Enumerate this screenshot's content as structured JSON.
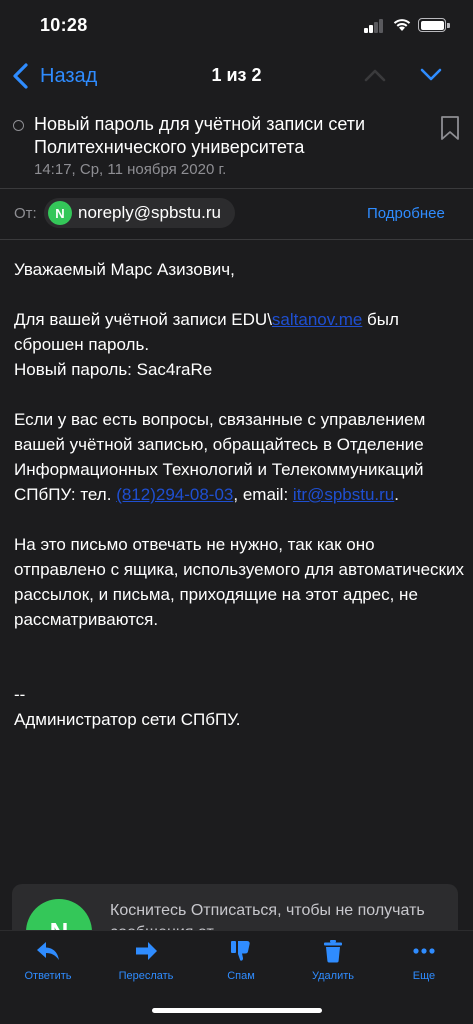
{
  "status_bar": {
    "time": "10:28"
  },
  "nav": {
    "back_label": "Назад",
    "counter": "1 из 2"
  },
  "message": {
    "subject": "Новый пароль для учётной записи сети Политехнического университета",
    "date": "14:17, Ср, 11 ноября 2020 г.",
    "from_label": "От:",
    "sender_initial": "N",
    "sender_email": "noreply@spbstu.ru",
    "details_label": "Подробнее"
  },
  "body": {
    "greeting": "Уважаемый Марс Азизович,",
    "reset_prefix": "Для вашей учётной записи EDU\\",
    "reset_login": "saltanov.me",
    "reset_suffix": " был сброшен пароль.",
    "new_password_line": "Новый пароль: Sac4raRe",
    "questions_text": "Если у вас есть вопросы, связанные с управлением вашей учётной записью, обращайтесь в Отделение Информационных Технологий и Телекоммуникаций СПбПУ: тел. ",
    "phone": "(812)294-08-03",
    "email_sep": ", email: ",
    "support_email": "itr@spbstu.ru",
    "end_period": ".",
    "no_reply_text": "На это письмо отвечать не нужно, так как оно отправлено с ящика, используемого для автоматических рассылок, и письма, приходящие на этот адрес, не рассматриваются.",
    "sig_dash": "--",
    "signature": "Администратор сети СПбПУ."
  },
  "unsubscribe": {
    "avatar_initial": "N",
    "text": "Коснитесь Отписаться, чтобы не получать сообщения от"
  },
  "toolbar": {
    "reply": "Ответить",
    "forward": "Переслать",
    "spam": "Спам",
    "delete": "Удалить",
    "more": "Еще"
  },
  "colors": {
    "background": "#1c1c1e",
    "accent": "#2f8cff",
    "avatar": "#34c759",
    "link": "#1f4fd1",
    "secondary_text": "#8e8e93"
  }
}
